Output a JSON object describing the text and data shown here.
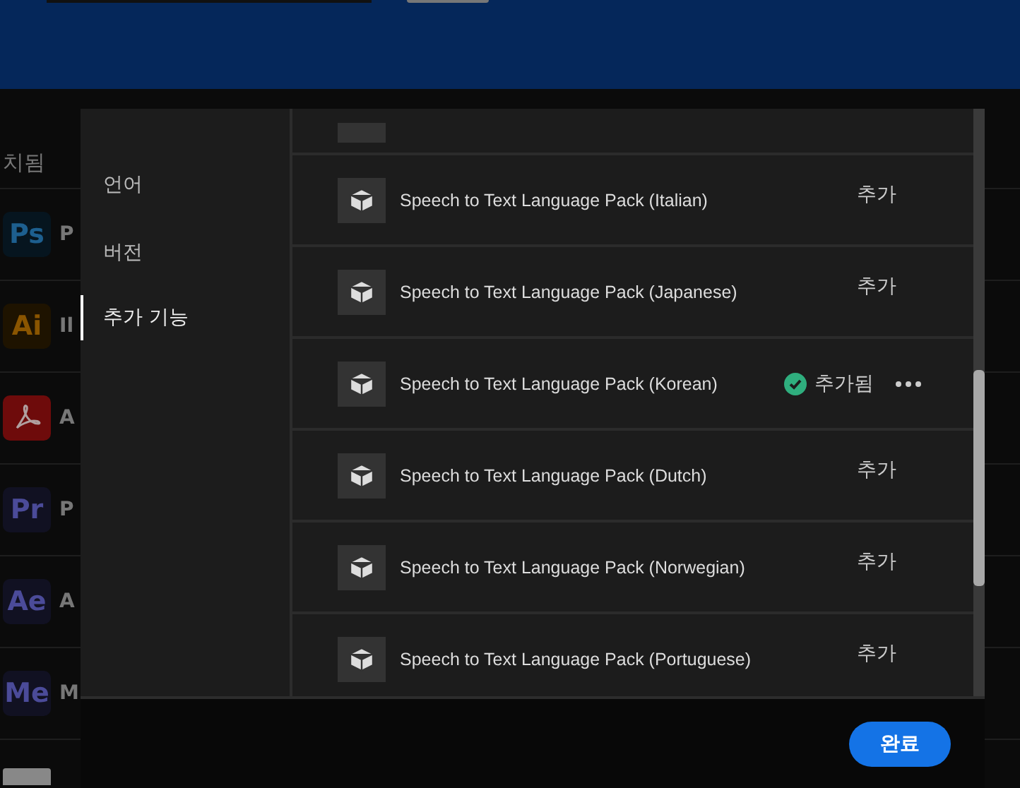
{
  "background_app": {
    "section_heading": "치됨",
    "apps": [
      {
        "kind": "badge",
        "badge": "Ps",
        "name": "P",
        "color": "#1d5f8f"
      },
      {
        "kind": "badge",
        "badge": "Ai",
        "name": "Il",
        "color": "#8a5500"
      },
      {
        "kind": "pdf",
        "name": "A",
        "color": "#b0a0a0"
      },
      {
        "kind": "badge",
        "badge": "Pr",
        "name": "P",
        "color": "#4b4b99"
      },
      {
        "kind": "badge",
        "badge": "Ae",
        "name": "A",
        "color": "#4b4b99"
      },
      {
        "kind": "badge",
        "badge": "Me",
        "name": "M",
        "color": "#4b4b99"
      }
    ]
  },
  "dialog": {
    "nav": [
      {
        "label": "언어",
        "selected": false
      },
      {
        "label": "버전",
        "selected": false
      },
      {
        "label": "추가 기능",
        "selected": true
      }
    ],
    "items": [
      {
        "name": "Speech to Text Language Pack (Italian)",
        "added": false,
        "action": "추가"
      },
      {
        "name": "Speech to Text Language Pack (Japanese)",
        "added": false,
        "action": "추가"
      },
      {
        "name": "Speech to Text Language Pack (Korean)",
        "added": true,
        "action": "추가됨"
      },
      {
        "name": "Speech to Text Language Pack (Dutch)",
        "added": false,
        "action": "추가"
      },
      {
        "name": "Speech to Text Language Pack (Norwegian)",
        "added": false,
        "action": "추가"
      },
      {
        "name": "Speech to Text Language Pack (Portuguese)",
        "added": false,
        "action": "추가"
      }
    ],
    "done_button": "완료"
  }
}
